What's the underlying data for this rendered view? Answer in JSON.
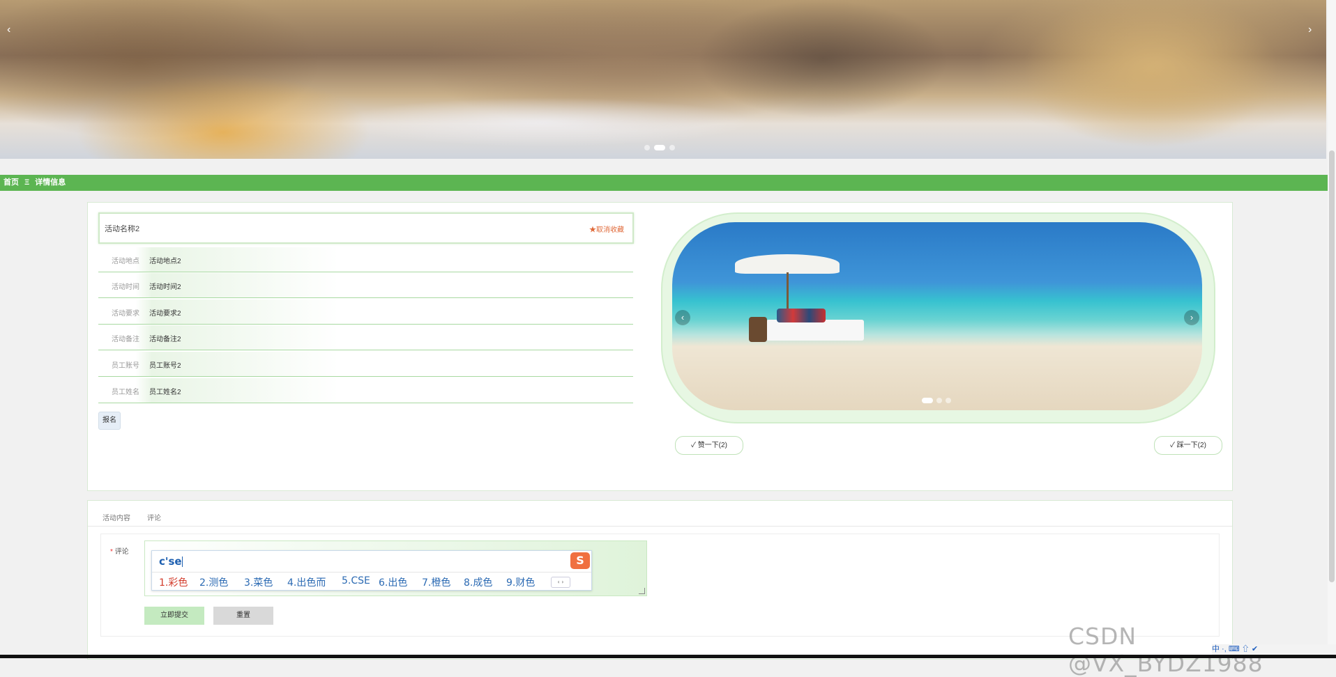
{
  "banner": {
    "prev": "‹",
    "next": "›",
    "dots": 3,
    "active_dot": 1
  },
  "breadcrumb": {
    "home": "首页",
    "separator": "Ξ",
    "current": "详情信息"
  },
  "detail": {
    "title": "活动名称2",
    "favorite": "★取消收藏",
    "fields": [
      {
        "label": "活动地点",
        "value": "活动地点2"
      },
      {
        "label": "活动时间",
        "value": "活动时间2"
      },
      {
        "label": "活动要求",
        "value": "活动要求2"
      },
      {
        "label": "活动备注",
        "value": "活动备注2"
      },
      {
        "label": "员工账号",
        "value": "员工账号2"
      },
      {
        "label": "员工姓名",
        "value": "员工姓名2"
      }
    ],
    "signup_button": "报名",
    "like_button": "赞一下(2)",
    "dislike_button": "踩一下(2)",
    "carousel": {
      "prev": "‹",
      "next": "›",
      "dots": 3,
      "active_dot": 0
    }
  },
  "comment_panel": {
    "tabs": [
      "活动内容",
      "评论"
    ],
    "label_required": "*",
    "label": "评论",
    "submit_button": "立即提交",
    "reset_button": "重置"
  },
  "ime": {
    "composition": "c'se",
    "logo": "S",
    "candidates": [
      "1.彩色",
      "2.测色",
      "3.菜色",
      "4.出色而",
      "5.CSE",
      "6.出色",
      "7.橙色",
      "8.成色",
      "9.财色"
    ],
    "pager": "‹ ›"
  },
  "watermark": "CSDN @VX_BYDZ1988",
  "tray": "中 ·, ⌨ ⇧ ✔"
}
